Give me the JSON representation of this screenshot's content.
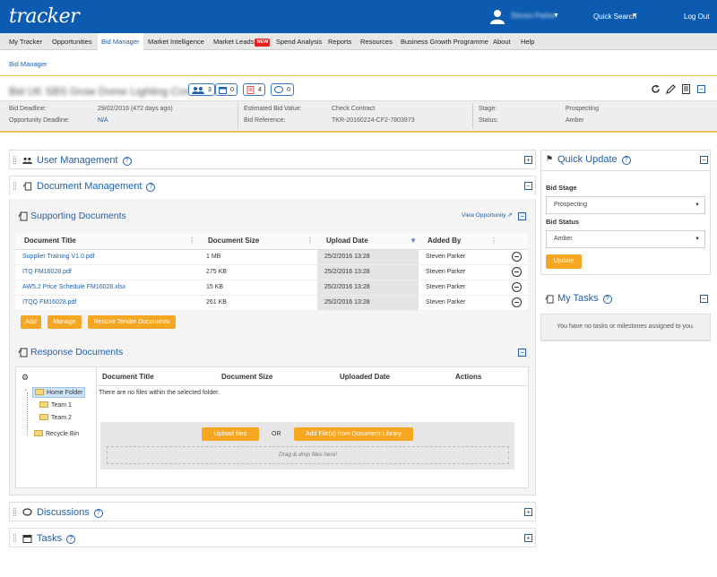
{
  "header": {
    "logo": "tracker",
    "user_name": "Steven Parker",
    "quick_search": "Quick Search",
    "logout": "Log Out"
  },
  "nav": {
    "items": [
      "My Tracker",
      "Opportunities",
      "Bid Manager",
      "Market Intelligence",
      "Market Leads",
      "Spend Analysis",
      "Reports",
      "Resources",
      "Business Growth Programme",
      "About",
      "Help"
    ],
    "new_badge": "NEW"
  },
  "breadcrumb": "Bid Manager",
  "bid": {
    "title": "Bid UK SBS Grow Dome Lighting Controls",
    "counters": {
      "users": "3",
      "calendar": "0",
      "documents": "4",
      "discussions": "0"
    },
    "deadline_label": "Bid Deadline:",
    "deadline_value": "29/02/2016 (472 days ago)",
    "opp_deadline_label": "Opportunity Deadline:",
    "opp_deadline_value": "N/A",
    "est_value_label": "Estimated Bid Value:",
    "est_value_value": "Check Contract",
    "reference_label": "Bid Reference:",
    "reference_value": "TKR-20160224-CF2-7803973",
    "stage_label": "Stage:",
    "stage_value": "Prospecting",
    "status_label": "Status:",
    "status_value": "Amber"
  },
  "panels": {
    "user_management": "User Management",
    "document_management": "Document Management",
    "supporting_documents": "Supporting Documents",
    "view_opportunity": "View Opportunity",
    "response_documents": "Response Documents",
    "discussions": "Discussions",
    "tasks": "Tasks"
  },
  "supporting_table": {
    "columns": [
      "Document Title",
      "Document Size",
      "Upload Date",
      "Added By"
    ],
    "rows": [
      {
        "title": "Supplier Training V1.0.pdf",
        "size": "1 MB",
        "date": "25/2/2016 13:28",
        "by": "Steven Parker"
      },
      {
        "title": "ITQ FM16028.pdf",
        "size": "275 KB",
        "date": "25/2/2016 13:28",
        "by": "Steven Parker"
      },
      {
        "title": "AW5.2 Price Schedule FM16028.xlsx",
        "size": "15 KB",
        "date": "25/2/2016 13:28",
        "by": "Steven Parker"
      },
      {
        "title": "ITQQ FM16028.pdf",
        "size": "261 KB",
        "date": "25/2/2016 13:28",
        "by": "Steven Parker"
      }
    ],
    "buttons": {
      "add": "Add",
      "manage": "Manage",
      "restore": "Restore Tender Documents"
    }
  },
  "response": {
    "columns": [
      "Document Title",
      "Document Size",
      "Uploaded Date",
      "Actions"
    ],
    "tree": {
      "home": "Home Folder",
      "team1": "Team 1",
      "team2": "Team 2",
      "recycle": "Recycle Bin"
    },
    "empty_message": "There are no files within the selected folder.",
    "upload_button": "Upload files",
    "or_text": "OR",
    "library_button": "Add File(s) from Document Library",
    "drop_text": "Drag & drop files here!"
  },
  "quick_update": {
    "title": "Quick Update",
    "stage_label": "Bid Stage",
    "stage_value": "Prospecting",
    "status_label": "Bid Status",
    "status_value": "Amber",
    "update_button": "Update"
  },
  "my_tasks": {
    "title": "My Tasks",
    "empty": "You have no tasks or milestones assigned to you."
  },
  "colors": {
    "brand": "#0d5bb0",
    "accent": "#f5a623",
    "link": "#1f5fa8"
  }
}
